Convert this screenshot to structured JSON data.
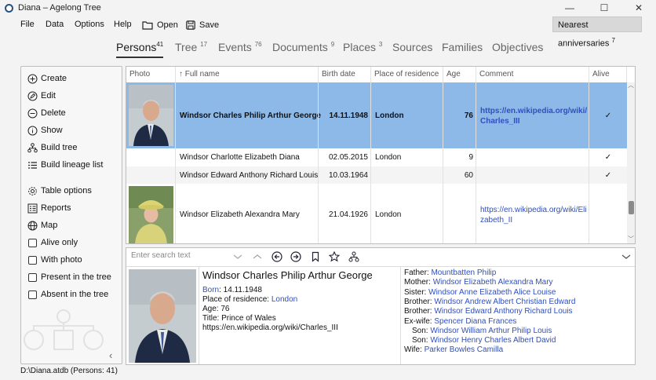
{
  "window": {
    "title": "Diana – Agelong Tree"
  },
  "menu": {
    "items": [
      "File",
      "Data",
      "Options",
      "Help"
    ],
    "open_label": "Open",
    "save_label": "Save",
    "nearest_label": "Nearest anniversaries",
    "nearest_count": "7"
  },
  "tabs": [
    {
      "label": "Persons",
      "count": "41"
    },
    {
      "label": "Tree",
      "count": "17"
    },
    {
      "label": "Events",
      "count": "76"
    },
    {
      "label": "Documents",
      "count": "9"
    },
    {
      "label": "Places",
      "count": "3"
    },
    {
      "label": "Sources",
      "count": ""
    },
    {
      "label": "Families",
      "count": ""
    },
    {
      "label": "Objectives",
      "count": ""
    }
  ],
  "sidebar": {
    "actions": [
      "Create",
      "Edit",
      "Delete",
      "Show",
      "Build tree",
      "Build lineage list"
    ],
    "tools": [
      "Table options",
      "Reports",
      "Map"
    ],
    "filters": [
      "Alive only",
      "With photo",
      "Present in the tree",
      "Absent in the tree"
    ]
  },
  "grid": {
    "headers": [
      "Photo",
      "↑ Full name",
      "Birth date",
      "Place of residence",
      "Age",
      "Comment",
      "Alive"
    ],
    "rows": [
      {
        "name": "Windsor Charles Philip Arthur George",
        "birth": "14.11.1948",
        "place": "London",
        "age": "76",
        "comment1": "https://en.wikipedia.org/wiki/",
        "comment2": "Charles_III",
        "alive": "✓"
      },
      {
        "name": "Windsor Charlotte Elizabeth Diana",
        "birth": "02.05.2015",
        "place": "London",
        "age": "9",
        "comment1": "",
        "comment2": "",
        "alive": "✓"
      },
      {
        "name": "Windsor Edward Anthony Richard Louis",
        "birth": "10.03.1964",
        "place": "",
        "age": "60",
        "comment1": "",
        "comment2": "",
        "alive": "✓"
      },
      {
        "name": "Windsor Elizabeth Alexandra Mary",
        "birth": "21.04.1926",
        "place": "London",
        "age": "",
        "comment1": "https://en.wikipedia.org/wiki/Eli",
        "comment2": "zabeth_II",
        "alive": ""
      }
    ]
  },
  "detail": {
    "search_placeholder": "Enter search text",
    "name": "Windsor Charles Philip Arthur George",
    "born_label": "Born",
    "born_value": ": 14.11.1948",
    "residence_label": "Place of residence: ",
    "residence_value": "London",
    "age": "Age: 76",
    "title": "Title: Prince of Wales",
    "link": "https://en.wikipedia.org/wiki/Charles_III",
    "relations": [
      {
        "label": "Father: ",
        "value": "Mountbatten Philip",
        "indent": false
      },
      {
        "label": "Mother: ",
        "value": "Windsor Elizabeth Alexandra Mary",
        "indent": false
      },
      {
        "label": "Sister: ",
        "value": "Windsor Anne Elizabeth Alice Louise",
        "indent": false
      },
      {
        "label": "Brother: ",
        "value": "Windsor Andrew Albert Christian Edward",
        "indent": false
      },
      {
        "label": "Brother: ",
        "value": "Windsor Edward Anthony Richard Louis",
        "indent": false
      },
      {
        "label": "Ex-wife: ",
        "value": "Spencer Diana Frances",
        "indent": false
      },
      {
        "label": "Son: ",
        "value": "Windsor William Arthur Philip Louis",
        "indent": true
      },
      {
        "label": "Son: ",
        "value": "Windsor Henry Charles Albert David",
        "indent": true
      },
      {
        "label": "Wife: ",
        "value": "Parker Bowles Camilla",
        "indent": false
      }
    ]
  },
  "status": "D:\\Diana.atdb (Persons: 41)"
}
